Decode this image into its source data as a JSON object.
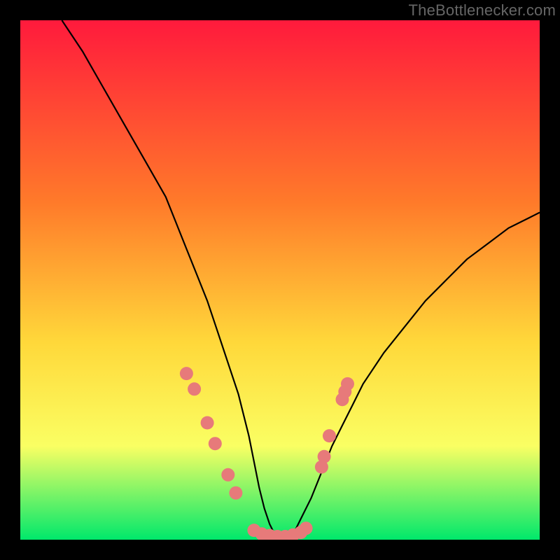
{
  "watermark": "TheBottlenecker.com",
  "colors": {
    "bg": "#000000",
    "grad_top": "#ff1a3c",
    "grad_mid1": "#ff7a2a",
    "grad_mid2": "#ffd83a",
    "grad_mid3": "#faff63",
    "grad_bottom": "#00e86b",
    "curve": "#000000",
    "marker_fill": "#e77a7a",
    "marker_stroke": "#c96666"
  },
  "chart_data": {
    "type": "line",
    "title": "",
    "xlabel": "",
    "ylabel": "",
    "xlim": [
      0,
      100
    ],
    "ylim": [
      0,
      100
    ],
    "x": [
      8,
      12,
      16,
      20,
      24,
      28,
      30,
      32,
      34,
      36,
      38,
      40,
      42,
      44,
      45,
      46,
      47,
      48,
      49,
      50,
      51,
      52,
      53,
      54,
      56,
      58,
      60,
      62,
      64,
      66,
      70,
      74,
      78,
      82,
      86,
      90,
      94,
      98,
      100
    ],
    "y": [
      100,
      94,
      87,
      80,
      73,
      66,
      61,
      56,
      51,
      46,
      40,
      34,
      28,
      20,
      15,
      10,
      6,
      3,
      1,
      0.5,
      0.5,
      1,
      2,
      4,
      8,
      13,
      18,
      22,
      26,
      30,
      36,
      41,
      46,
      50,
      54,
      57,
      60,
      62,
      63
    ],
    "markers": [
      {
        "x": 32,
        "y": 32
      },
      {
        "x": 33.5,
        "y": 29
      },
      {
        "x": 36,
        "y": 22.5
      },
      {
        "x": 37.5,
        "y": 18.5
      },
      {
        "x": 40,
        "y": 12.5
      },
      {
        "x": 41.5,
        "y": 9
      },
      {
        "x": 45,
        "y": 1.8
      },
      {
        "x": 46.5,
        "y": 1.1
      },
      {
        "x": 48,
        "y": 0.8
      },
      {
        "x": 49.5,
        "y": 0.6
      },
      {
        "x": 51,
        "y": 0.6
      },
      {
        "x": 52.5,
        "y": 0.9
      },
      {
        "x": 54,
        "y": 1.4
      },
      {
        "x": 55,
        "y": 2.2
      },
      {
        "x": 58,
        "y": 14
      },
      {
        "x": 58.5,
        "y": 16
      },
      {
        "x": 59.5,
        "y": 20
      },
      {
        "x": 62,
        "y": 27
      },
      {
        "x": 62.5,
        "y": 28.5
      },
      {
        "x": 63,
        "y": 30
      }
    ]
  }
}
